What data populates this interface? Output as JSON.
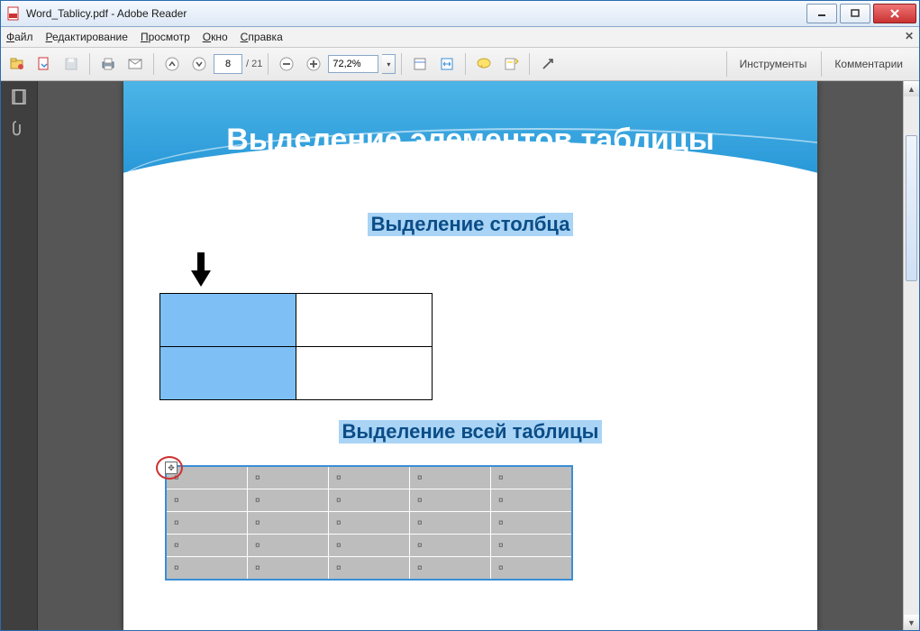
{
  "window": {
    "title": "Word_Tablicy.pdf - Adobe Reader"
  },
  "menu": {
    "file": "Файл",
    "edit": "Редактирование",
    "view": "Просмотр",
    "window": "Окно",
    "help": "Справка"
  },
  "toolbar": {
    "page_current": "8",
    "page_total": "/ 21",
    "zoom": "72,2%"
  },
  "sidepanel": {
    "tools": "Инструменты",
    "comments": "Комментарии"
  },
  "slide": {
    "title": "Выделение элементов таблицы",
    "sub_column": "Выделение столбца",
    "sub_table": "Выделение всей таблицы",
    "cell_mark": "¤"
  }
}
